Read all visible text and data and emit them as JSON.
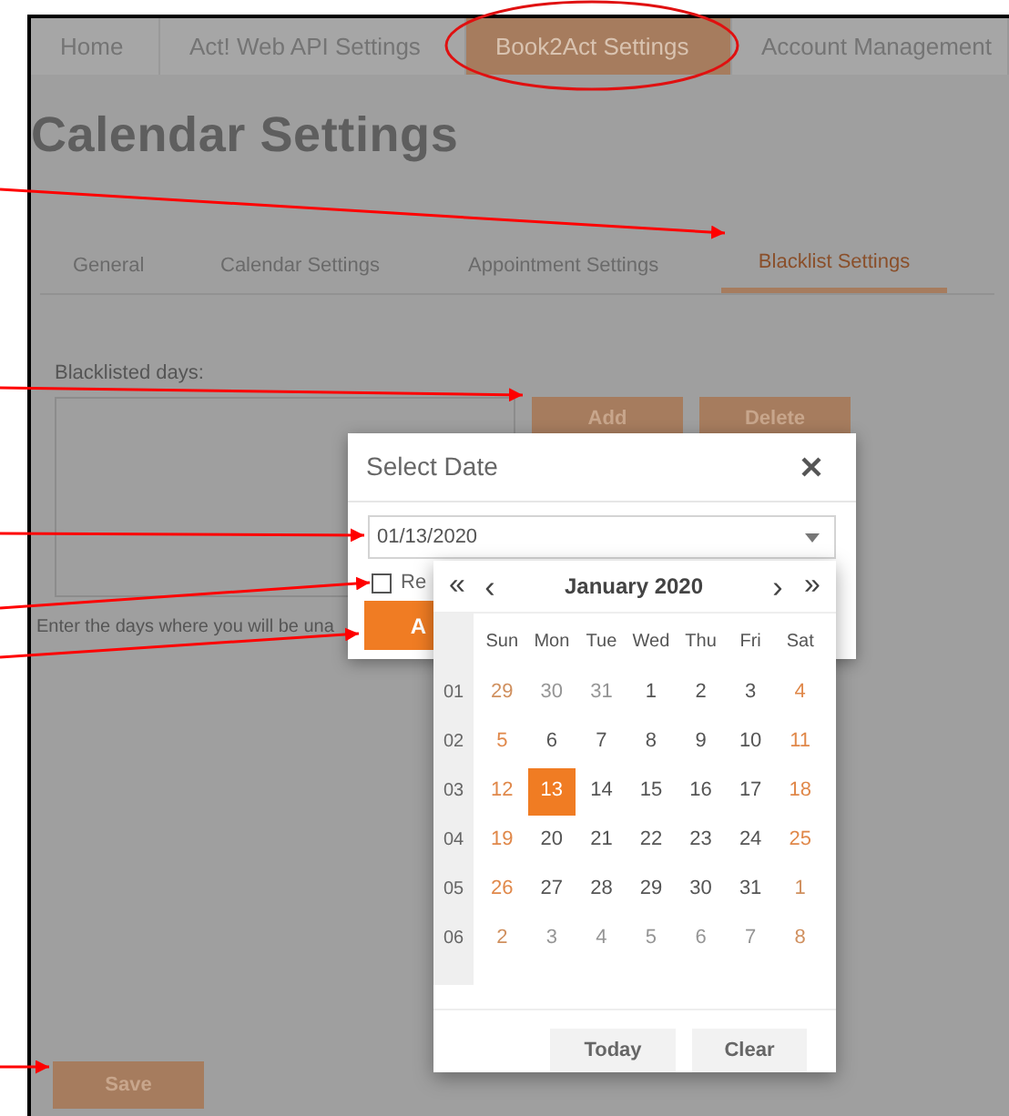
{
  "top_nav": {
    "tabs": [
      {
        "label": "Home",
        "selected": false
      },
      {
        "label": "Act! Web API Settings",
        "selected": false
      },
      {
        "label": "Book2Act Settings",
        "selected": true
      },
      {
        "label": "Account Management",
        "selected": false
      }
    ]
  },
  "page_title": "Calendar Settings",
  "sub_tabs": [
    {
      "label": "General",
      "selected": false
    },
    {
      "label": "Calendar Settings",
      "selected": false
    },
    {
      "label": "Appointment Settings",
      "selected": false
    },
    {
      "label": "Blacklist Settings",
      "selected": true
    }
  ],
  "blacklist": {
    "label": "Blacklisted days:",
    "buttons": [
      "Add",
      "Delete"
    ],
    "hint": "Enter the days where you will be una"
  },
  "save_button": "Save",
  "dialog": {
    "title": "Select Date",
    "date_field": {
      "value": "01/13/2020"
    },
    "checkbox": {
      "label": "Re",
      "checked": false
    },
    "button": "A"
  },
  "calendar": {
    "prev_year": "«",
    "prev": "‹",
    "title": "January 2020",
    "next": "›",
    "next_year": "»",
    "weekdays": [
      "Sun",
      "Mon",
      "Tue",
      "Wed",
      "Thu",
      "Fri",
      "Sat"
    ],
    "weeks": [
      {
        "number": "01",
        "days": [
          {
            "label": "29",
            "outside": true,
            "selected": false
          },
          {
            "label": "30",
            "outside": true,
            "selected": false
          },
          {
            "label": "31",
            "outside": true,
            "selected": false
          },
          {
            "label": "1",
            "outside": false,
            "selected": false
          },
          {
            "label": "2",
            "outside": false,
            "selected": false
          },
          {
            "label": "3",
            "outside": false,
            "selected": false
          },
          {
            "label": "4",
            "outside": false,
            "selected": false
          }
        ]
      },
      {
        "number": "02",
        "days": [
          {
            "label": "5",
            "outside": false,
            "selected": false
          },
          {
            "label": "6",
            "outside": false,
            "selected": false
          },
          {
            "label": "7",
            "outside": false,
            "selected": false
          },
          {
            "label": "8",
            "outside": false,
            "selected": false
          },
          {
            "label": "9",
            "outside": false,
            "selected": false
          },
          {
            "label": "10",
            "outside": false,
            "selected": false
          },
          {
            "label": "11",
            "outside": false,
            "selected": false
          }
        ]
      },
      {
        "number": "03",
        "days": [
          {
            "label": "12",
            "outside": false,
            "selected": false
          },
          {
            "label": "13",
            "outside": false,
            "selected": true
          },
          {
            "label": "14",
            "outside": false,
            "selected": false
          },
          {
            "label": "15",
            "outside": false,
            "selected": false
          },
          {
            "label": "16",
            "outside": false,
            "selected": false
          },
          {
            "label": "17",
            "outside": false,
            "selected": false
          },
          {
            "label": "18",
            "outside": false,
            "selected": false
          }
        ]
      },
      {
        "number": "04",
        "days": [
          {
            "label": "19",
            "outside": false,
            "selected": false
          },
          {
            "label": "20",
            "outside": false,
            "selected": false
          },
          {
            "label": "21",
            "outside": false,
            "selected": false
          },
          {
            "label": "22",
            "outside": false,
            "selected": false
          },
          {
            "label": "23",
            "outside": false,
            "selected": false
          },
          {
            "label": "24",
            "outside": false,
            "selected": false
          },
          {
            "label": "25",
            "outside": false,
            "selected": false
          }
        ]
      },
      {
        "number": "05",
        "days": [
          {
            "label": "26",
            "outside": false,
            "selected": false
          },
          {
            "label": "27",
            "outside": false,
            "selected": false
          },
          {
            "label": "28",
            "outside": false,
            "selected": false
          },
          {
            "label": "29",
            "outside": false,
            "selected": false
          },
          {
            "label": "30",
            "outside": false,
            "selected": false
          },
          {
            "label": "31",
            "outside": false,
            "selected": false
          },
          {
            "label": "1",
            "outside": true,
            "selected": false
          }
        ]
      },
      {
        "number": "06",
        "days": [
          {
            "label": "2",
            "outside": true,
            "selected": false
          },
          {
            "label": "3",
            "outside": true,
            "selected": false
          },
          {
            "label": "4",
            "outside": true,
            "selected": false
          },
          {
            "label": "5",
            "outside": true,
            "selected": false
          },
          {
            "label": "6",
            "outside": true,
            "selected": false
          },
          {
            "label": "7",
            "outside": true,
            "selected": false
          },
          {
            "label": "8",
            "outside": true,
            "selected": false
          }
        ]
      }
    ],
    "footer_buttons": [
      "Today",
      "Clear"
    ]
  }
}
